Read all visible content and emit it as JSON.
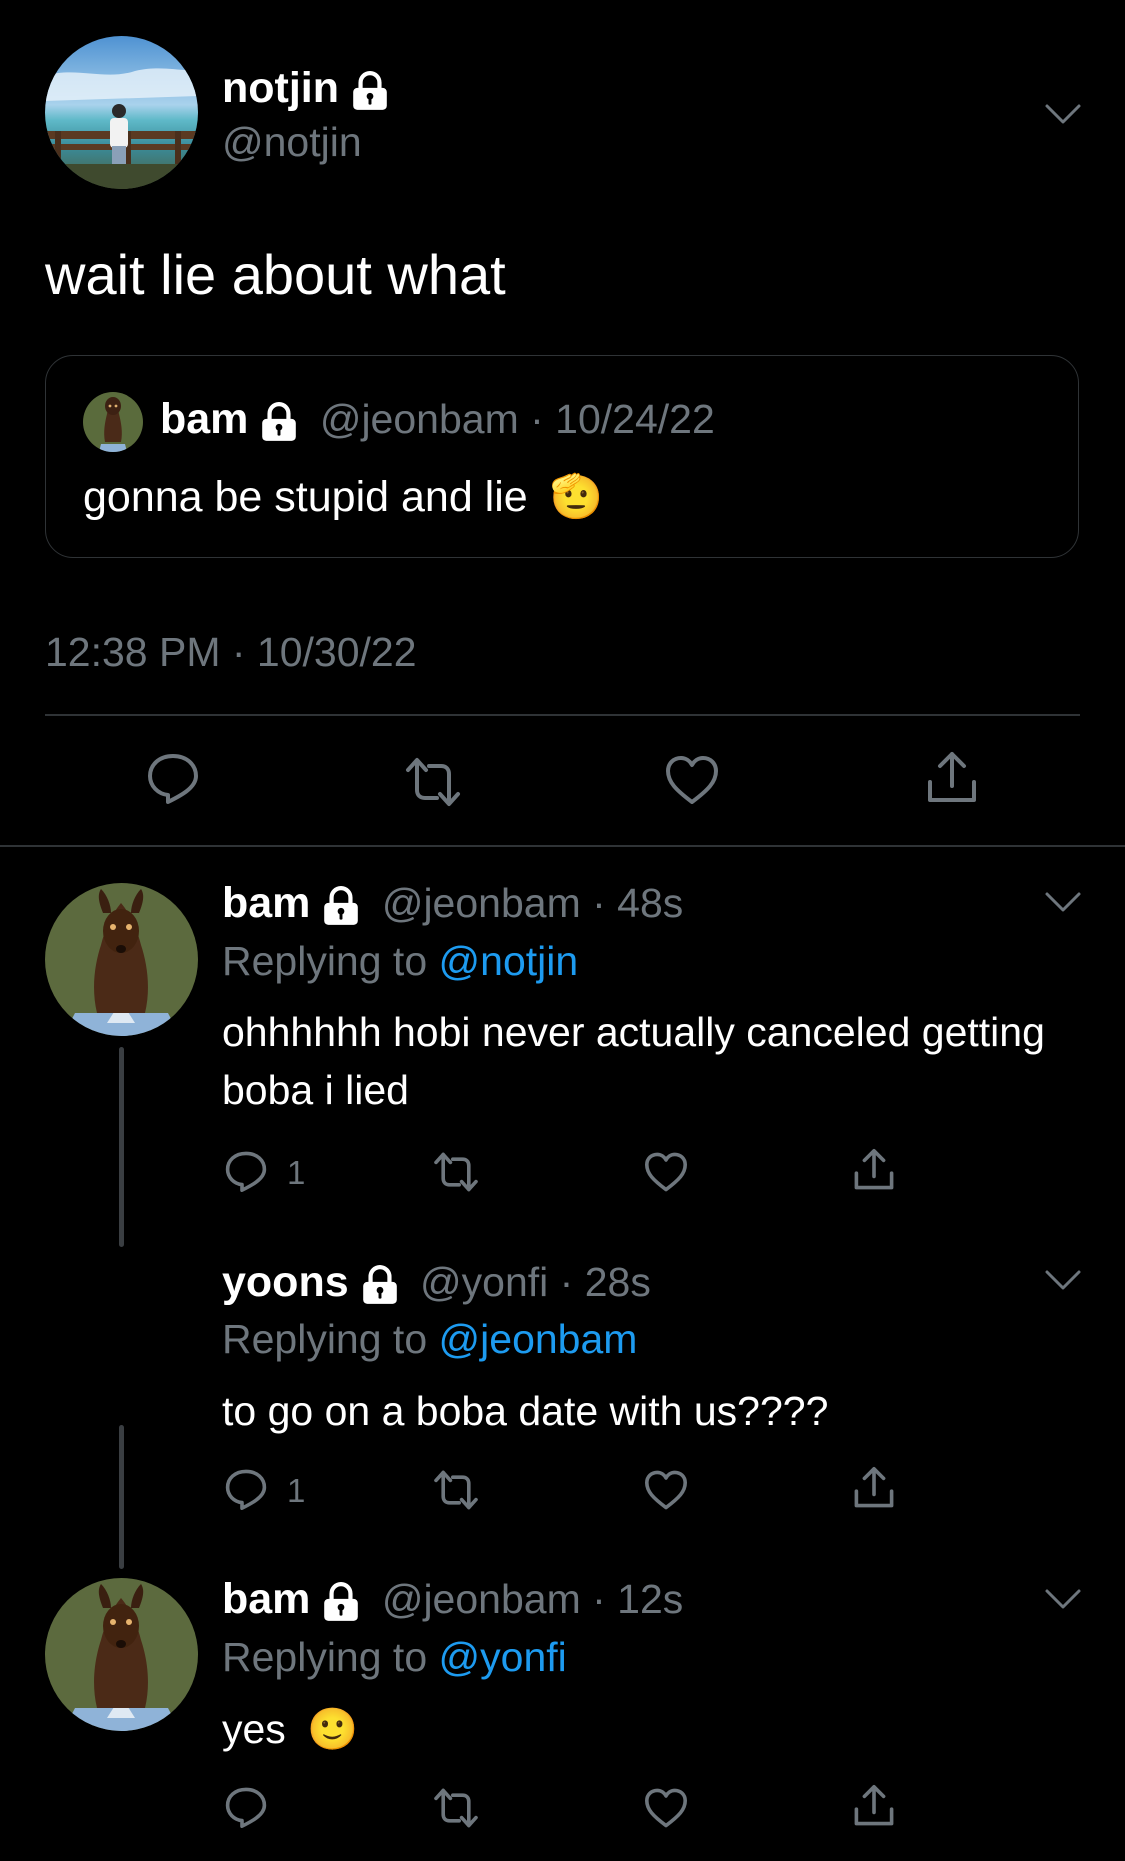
{
  "main_tweet": {
    "author_name": "notjin",
    "author_handle": "@notjin",
    "text": "wait lie about what",
    "timestamp": "12:38 PM · 10/30/22",
    "quoted": {
      "author_name": "bam",
      "author_handle": "@jeonbam",
      "date": "10/24/22",
      "text": "gonna be stupid and lie",
      "emoji": "🫡"
    }
  },
  "replies": [
    {
      "author_name": "bam",
      "author_handle": "@jeonbam",
      "time": "48s",
      "replying_label": "Replying to",
      "replying_to": "@notjin",
      "text": "ohhhhhh hobi never actually canceled getting boba i lied",
      "reply_count": "1"
    },
    {
      "author_name": "yoons",
      "author_handle": "@yonfi",
      "time": "28s",
      "replying_label": "Replying to",
      "replying_to": "@jeonbam",
      "text": "to go on a boba date with us????",
      "reply_count": "1"
    },
    {
      "author_name": "bam",
      "author_handle": "@jeonbam",
      "time": "12s",
      "replying_label": "Replying to",
      "replying_to": "@yonfi",
      "text": "yes",
      "emoji": "🙂",
      "reply_count": ""
    }
  ],
  "icons": [
    "lock-icon",
    "chevron-down-icon",
    "reply-icon",
    "retweet-icon",
    "like-icon",
    "share-icon"
  ],
  "colors": {
    "background": "#000000",
    "muted": "#6e767d",
    "link": "#1d9bf0",
    "border": "#2f3336"
  }
}
